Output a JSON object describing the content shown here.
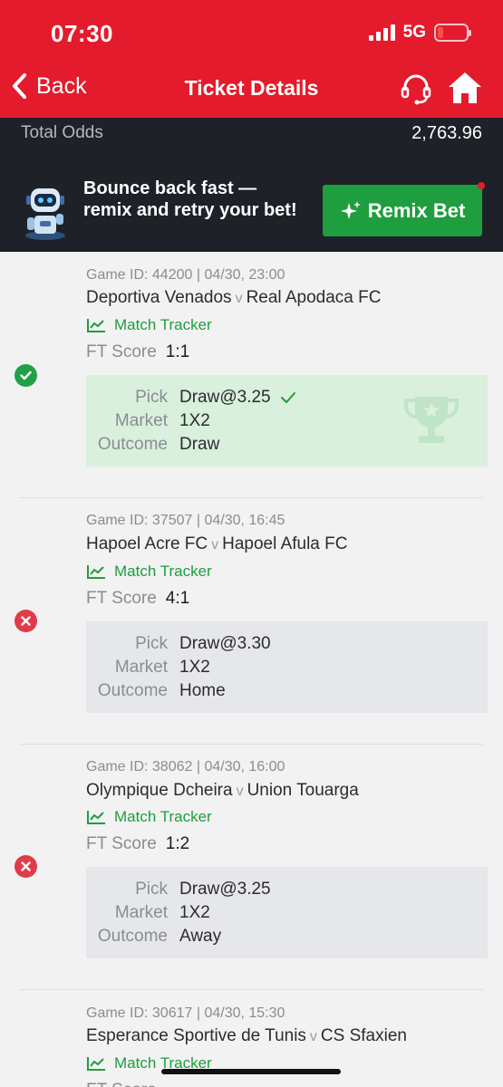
{
  "status_bar": {
    "time": "07:30",
    "network": "5G"
  },
  "nav": {
    "back_label": "Back",
    "title": "Ticket Details"
  },
  "summary": {
    "total_odds_label": "Total Odds",
    "total_odds_value": "2,763.96"
  },
  "promo": {
    "text": "Bounce back fast — remix and retry your bet!",
    "button_label": "Remix Bet"
  },
  "labels": {
    "match_tracker": "Match Tracker",
    "ft_score": "FT Score",
    "pick": "Pick",
    "market": "Market",
    "outcome": "Outcome",
    "vs": "v"
  },
  "bets": [
    {
      "meta": "Game ID: 44200 | 04/30, 23:00",
      "home": "Deportiva Venados",
      "away": "Real Apodaca FC",
      "ft_score": "1:1",
      "pick": "Draw@3.25",
      "market": "1X2",
      "outcome": "Draw",
      "status": "won"
    },
    {
      "meta": "Game ID: 37507 | 04/30, 16:45",
      "home": "Hapoel Acre FC",
      "away": "Hapoel Afula FC",
      "ft_score": "4:1",
      "pick": "Draw@3.30",
      "market": "1X2",
      "outcome": "Home",
      "status": "lost"
    },
    {
      "meta": "Game ID: 38062 | 04/30, 16:00",
      "home": "Olympique Dcheira",
      "away": "Union Touarga",
      "ft_score": "1:2",
      "pick": "Draw@3.25",
      "market": "1X2",
      "outcome": "Away",
      "status": "lost"
    },
    {
      "meta": "Game ID: 30617 | 04/30, 15:30",
      "home": "Esperance Sportive de Tunis",
      "away": "CS Sfaxien",
      "ft_score": "",
      "pick": "",
      "market": "",
      "outcome": "",
      "status": ""
    }
  ],
  "colors": {
    "brand_red": "#e41b2c",
    "dark_band": "#1e2128",
    "green": "#1e9e3e",
    "won_bg": "#d9f0dc",
    "lost_red": "#e13b4a"
  },
  "icons": {
    "back": "chevron-left-icon",
    "support": "headset-icon",
    "home": "home-icon",
    "won": "check-circle-icon",
    "lost": "x-circle-icon",
    "tracker": "line-chart-icon",
    "remix": "sparkle-icon"
  }
}
